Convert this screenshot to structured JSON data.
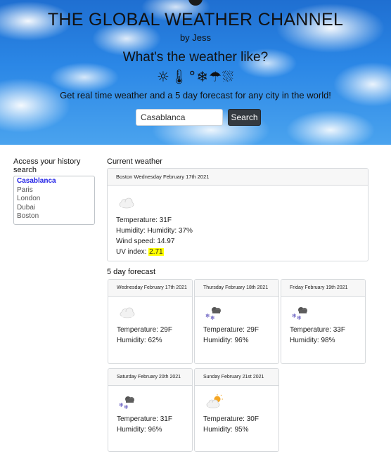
{
  "header": {
    "title": "THE GLOBAL WEATHER CHANNEL",
    "byline": "by Jess",
    "question": "What's the weather like?",
    "emoji_row": "☼🌡°❄☂⛆",
    "subtitle": "Get real time weather and a 5 day forecast for any city in the world!"
  },
  "search": {
    "value": "Casablanca",
    "button_label": "Search"
  },
  "history": {
    "title": "Access your history search",
    "items": [
      "Casablanca",
      "Paris",
      "London",
      "Dubai",
      "Boston"
    ]
  },
  "current": {
    "section_label": "Current weather",
    "header": "Boston Wednesday February 17th 2021",
    "icon": "cloud-icon",
    "temperature": "Temperature: 31F",
    "humidity": "Humidity: Humidity: 37%",
    "wind": "Wind speed: 14.97",
    "uv_label": "UV index:",
    "uv_value": "2.71"
  },
  "forecast": {
    "section_label": "5 day forecast",
    "days": [
      {
        "date": "Wednesday February 17th 2021",
        "icon": "cloud-icon",
        "temperature": "Temperature: 29F",
        "humidity": "Humidity: 62%"
      },
      {
        "date": "Thursday February 18th 2021",
        "icon": "snow-cloud-icon",
        "temperature": "Temperature: 29F",
        "humidity": "Humidity: 96%"
      },
      {
        "date": "Friday February 19th 2021",
        "icon": "snow-cloud-icon",
        "temperature": "Temperature: 33F",
        "humidity": "Humidity: 98%"
      },
      {
        "date": "Saturday February 20th 2021",
        "icon": "snow-cloud-icon",
        "temperature": "Temperature: 31F",
        "humidity": "Humidity: 96%"
      },
      {
        "date": "Sunday February 21st 2021",
        "icon": "sun-cloud-icon",
        "temperature": "Temperature: 30F",
        "humidity": "Humidity: 95%"
      }
    ]
  }
}
